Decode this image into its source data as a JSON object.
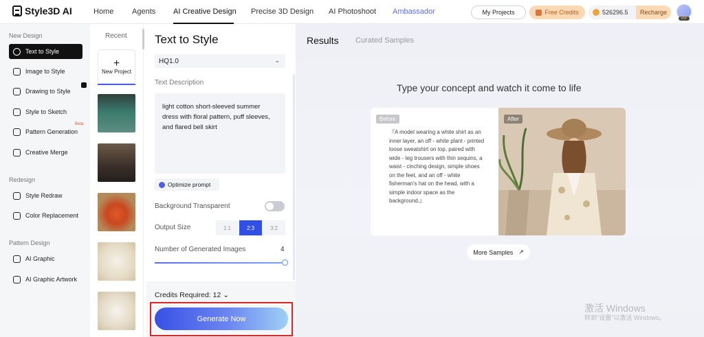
{
  "app": {
    "logo": "Style3D AI"
  },
  "nav": {
    "items": [
      "Home",
      "Agents",
      "AI Creative Design",
      "Precise 3D Design",
      "AI Photoshoot",
      "Ambassador"
    ],
    "my_projects": "My Projects",
    "free_credits": "Free Credits",
    "coins": "526296.5",
    "recharge": "Recharge",
    "vip": "VIP"
  },
  "sidebar": {
    "section_new": "New Design",
    "section_redesign": "Redesign",
    "section_pattern": "Pattern Design",
    "items": [
      {
        "label": "Text to Style",
        "icon": "text-style-icon"
      },
      {
        "label": "Image to Style",
        "icon": "image-style-icon"
      },
      {
        "label": "Drawing to Style",
        "icon": "drawing-style-icon"
      },
      {
        "label": "Style to Sketch",
        "icon": "sketch-icon"
      },
      {
        "label": "Pattern Generation",
        "icon": "pattern-icon"
      },
      {
        "label": "Creative Merge",
        "icon": "merge-icon"
      },
      {
        "label": "Style Redraw",
        "icon": "redraw-icon"
      },
      {
        "label": "Color Replacement",
        "icon": "color-icon"
      },
      {
        "label": "AI Graphic",
        "icon": "graphic-icon"
      },
      {
        "label": "AI Graphic Artwork",
        "icon": "artwork-icon"
      }
    ],
    "beta": "Beta"
  },
  "recent": {
    "label": "Recent",
    "new_project": "New Project",
    "thumbnails": [
      {
        "color_top": "#3a6b63",
        "color_bottom": "#6a8f86"
      },
      {
        "color_top": "#5a4a3c",
        "color_bottom": "#2b2622"
      },
      {
        "color_top": "#b87a3c",
        "color_bottom": "#e0582a"
      },
      {
        "color_top": "#efeadf",
        "color_bottom": "#d8cbb2"
      },
      {
        "color_top": "#f2efe8",
        "color_bottom": "#d9cfbd"
      }
    ]
  },
  "form": {
    "title": "Text to Style",
    "model": "HQ1.0",
    "text_description_label": "Text Description",
    "description": "light cotton short-sleeved summer dress with floral pattern, puff sleeves, and flared bell skirt",
    "optimize": "Optimize prompt",
    "background_transparent_label": "Background Transparent",
    "background_transparent": false,
    "output_size_label": "Output Size",
    "output_sizes": [
      "1:1",
      "2:3",
      "3:2"
    ],
    "selected_output_size": "2:3",
    "num_images_label": "Number of Generated Images",
    "num_images": "4",
    "credits_required": "Credits Required: 12",
    "generate": "Generate Now"
  },
  "results": {
    "tab_results": "Results",
    "tab_curated": "Curated Samples",
    "tagline": "Type your concept and watch it come to life",
    "before": "Before",
    "after": "After",
    "sample_text": "『A model wearing a white shirt as an inner layer, an off - white plant - printed loose sweatshirt on top, paired with wide - leg trousers with thin sequins, a waist - cinching design, simple shoes on the feet, and an off - white fisherman's hat on the head, with a simple indoor space as the background.』",
    "more_samples": "More Samples"
  },
  "watermark": {
    "line1": "激活 Windows",
    "line2": "转到\"设置\"以激活 Windows。"
  },
  "colors": {
    "accent": "#2f4fe6",
    "highlight_border": "#d92525"
  }
}
